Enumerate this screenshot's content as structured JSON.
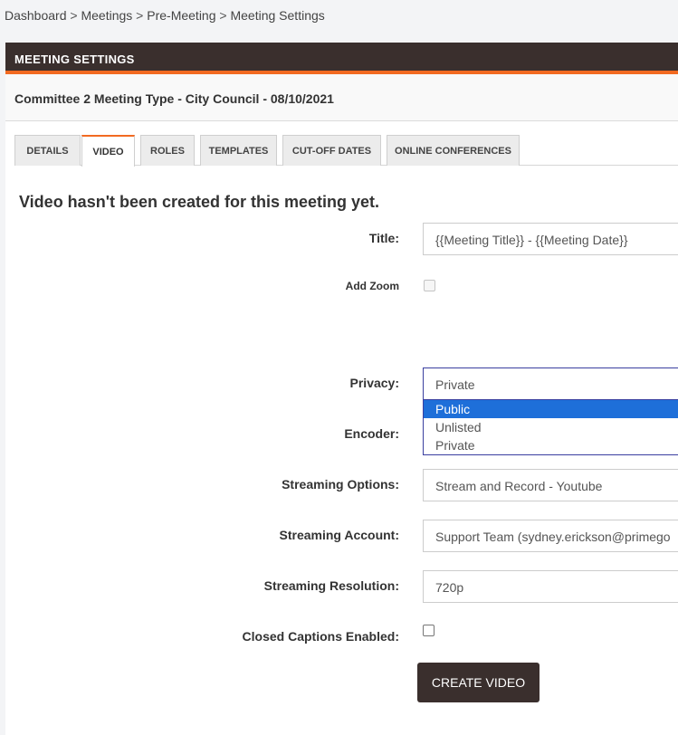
{
  "breadcrumb": [
    "Dashboard",
    "Meetings",
    "Pre-Meeting",
    "Meeting Settings"
  ],
  "breadcrumb_sep": " > ",
  "panel": {
    "title": "MEETING SETTINGS"
  },
  "meeting": {
    "subtitle": "Committee 2 Meeting Type - City Council - 08/10/2021"
  },
  "tabs": [
    {
      "label": "DETAILS"
    },
    {
      "label": "VIDEO"
    },
    {
      "label": "ROLES"
    },
    {
      "label": "TEMPLATES"
    },
    {
      "label": "CUT-OFF DATES"
    },
    {
      "label": "ONLINE CONFERENCES"
    }
  ],
  "active_tab": "VIDEO",
  "notice": "Video hasn't been created for this meeting yet.",
  "form": {
    "title_label": "Title:",
    "title_value": "{{Meeting Title}} - {{Meeting Date}}",
    "add_zoom_label": "Add Zoom",
    "add_zoom_checked": false,
    "privacy_label": "Privacy:",
    "privacy_value": "Private",
    "privacy_options": [
      "Public",
      "Unlisted",
      "Private"
    ],
    "privacy_highlighted": "Public",
    "encoder_label": "Encoder:",
    "streaming_options_label": "Streaming Options:",
    "streaming_options_value": "Stream and Record - Youtube",
    "streaming_account_label": "Streaming Account:",
    "streaming_account_value": "Support Team (sydney.erickson@primego",
    "streaming_resolution_label": "Streaming Resolution:",
    "streaming_resolution_value": "720p",
    "closed_captions_label": "Closed Captions Enabled:",
    "closed_captions_checked": false,
    "create_button": "CREATE VIDEO"
  },
  "colors": {
    "header_bg": "#3a2f2d",
    "accent": "#f26a21",
    "select_highlight": "#1e6fd9",
    "button_bg": "#3a2f2d"
  }
}
